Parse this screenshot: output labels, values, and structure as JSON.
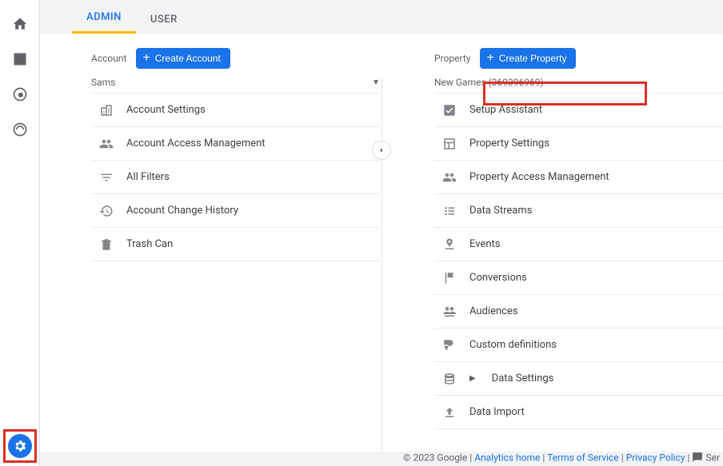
{
  "tabs": {
    "admin": "ADMIN",
    "user": "USER"
  },
  "account_col": {
    "label": "Account",
    "create_btn": "Create Account",
    "selected": "Sams",
    "items": [
      "Account Settings",
      "Account Access Management",
      "All Filters",
      "Account Change History",
      "Trash Can"
    ]
  },
  "property_col": {
    "label": "Property",
    "create_btn": "Create Property",
    "selected": "New Games (369396969)",
    "items": [
      "Setup Assistant",
      "Property Settings",
      "Property Access Management",
      "Data Streams",
      "Events",
      "Conversions",
      "Audiences",
      "Custom definitions",
      "Data Settings",
      "Data Import"
    ]
  },
  "footer": {
    "copyright": "© 2023 Google |",
    "analytics_home": "Analytics home",
    "tos": "Terms of Service",
    "privacy": "Privacy Policy",
    "send": "Ser"
  }
}
